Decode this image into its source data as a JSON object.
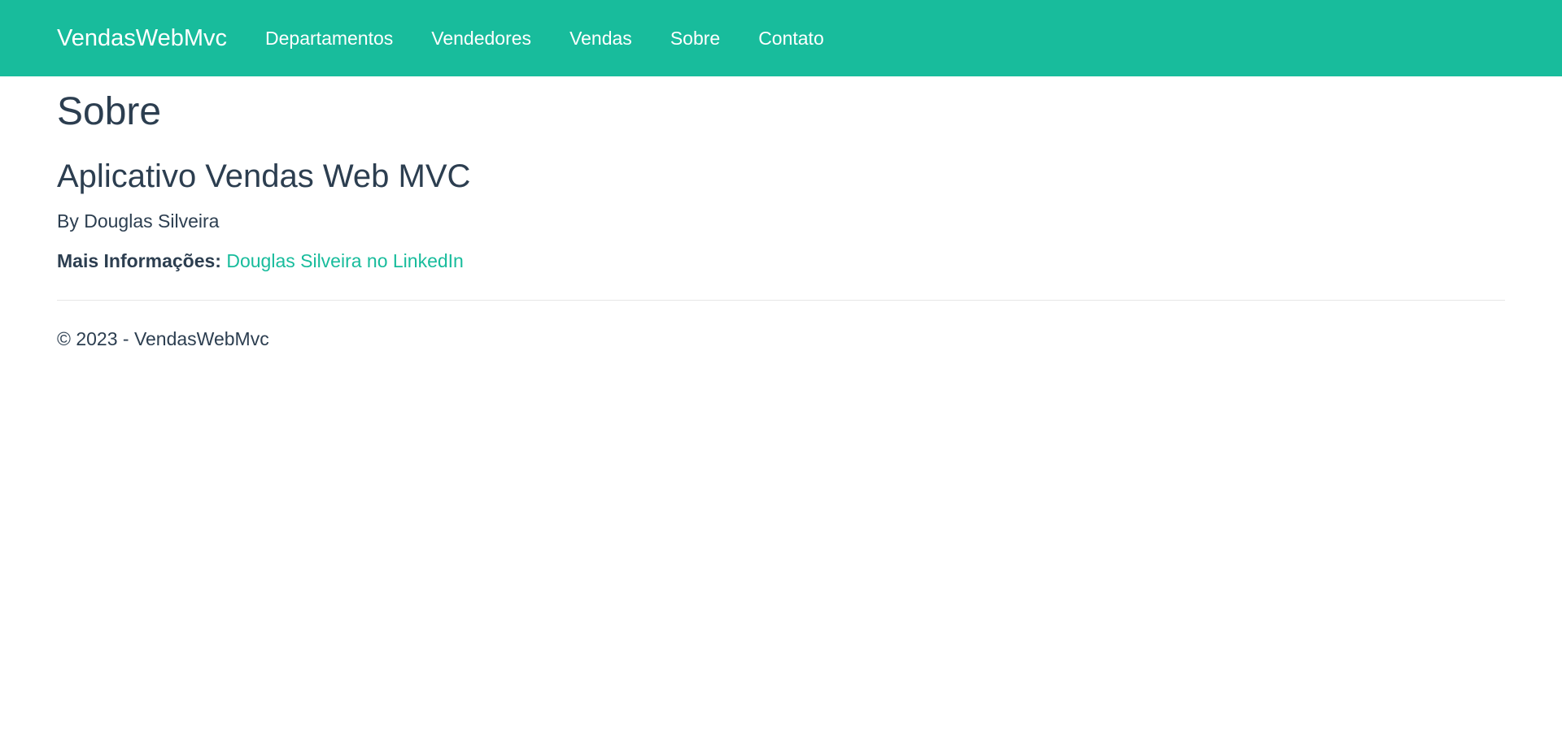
{
  "navbar": {
    "brand": "VendasWebMvc",
    "items": [
      {
        "label": "Departamentos"
      },
      {
        "label": "Vendedores"
      },
      {
        "label": "Vendas"
      },
      {
        "label": "Sobre"
      },
      {
        "label": "Contato"
      }
    ],
    "background_color": "#18bc9c"
  },
  "main": {
    "page_title": "Sobre",
    "app_title": "Aplicativo Vendas Web MVC",
    "byline": "By Douglas Silveira",
    "more_info_label": "Mais Informações:",
    "more_info_link": "Douglas Silveira no LinkedIn"
  },
  "footer": {
    "text": "© 2023 - VendasWebMvc"
  },
  "colors": {
    "text": "#2c3e50",
    "accent": "#18bc9c"
  }
}
